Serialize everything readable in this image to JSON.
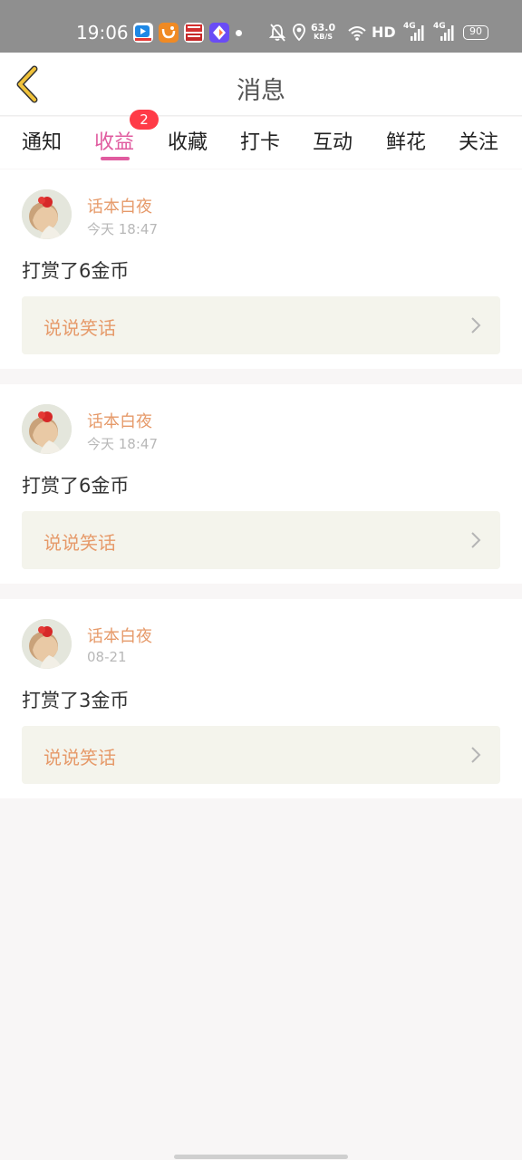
{
  "status_bar": {
    "time": "19:06",
    "net_speed": "63.0",
    "net_speed_unit": "KB/S",
    "hd_label": "HD",
    "signal_1": "4G",
    "signal_2": "4G",
    "battery": "90",
    "icons": [
      "video-app-icon",
      "uc-browser-icon",
      "news-app-icon",
      "app-store-icon",
      "mute-bell-icon",
      "location-icon",
      "wifi-icon",
      "signal-icon"
    ]
  },
  "header": {
    "title": "消息",
    "back_icon": "chevron-left-icon"
  },
  "tabs": [
    {
      "label": "通知",
      "active": false
    },
    {
      "label": "收益",
      "active": true,
      "badge": "2"
    },
    {
      "label": "收藏",
      "active": false
    },
    {
      "label": "打卡",
      "active": false
    },
    {
      "label": "互动",
      "active": false
    },
    {
      "label": "鲜花",
      "active": false
    },
    {
      "label": "关注",
      "active": false
    }
  ],
  "messages": [
    {
      "username": "话本白夜",
      "time": "今天 18:47",
      "text": "打赏了6金币",
      "link": "说说笑话"
    },
    {
      "username": "话本白夜",
      "time": "今天 18:47",
      "text": "打赏了6金币",
      "link": "说说笑话"
    },
    {
      "username": "话本白夜",
      "time": "08-21",
      "text": "打赏了3金币",
      "link": "说说笑话"
    }
  ],
  "colors": {
    "accent": "#e05b9f",
    "username": "#e69a6a",
    "badge": "#ff3b47",
    "status_bar": "#8f8f8f",
    "back_icon": "#f0c23a"
  }
}
